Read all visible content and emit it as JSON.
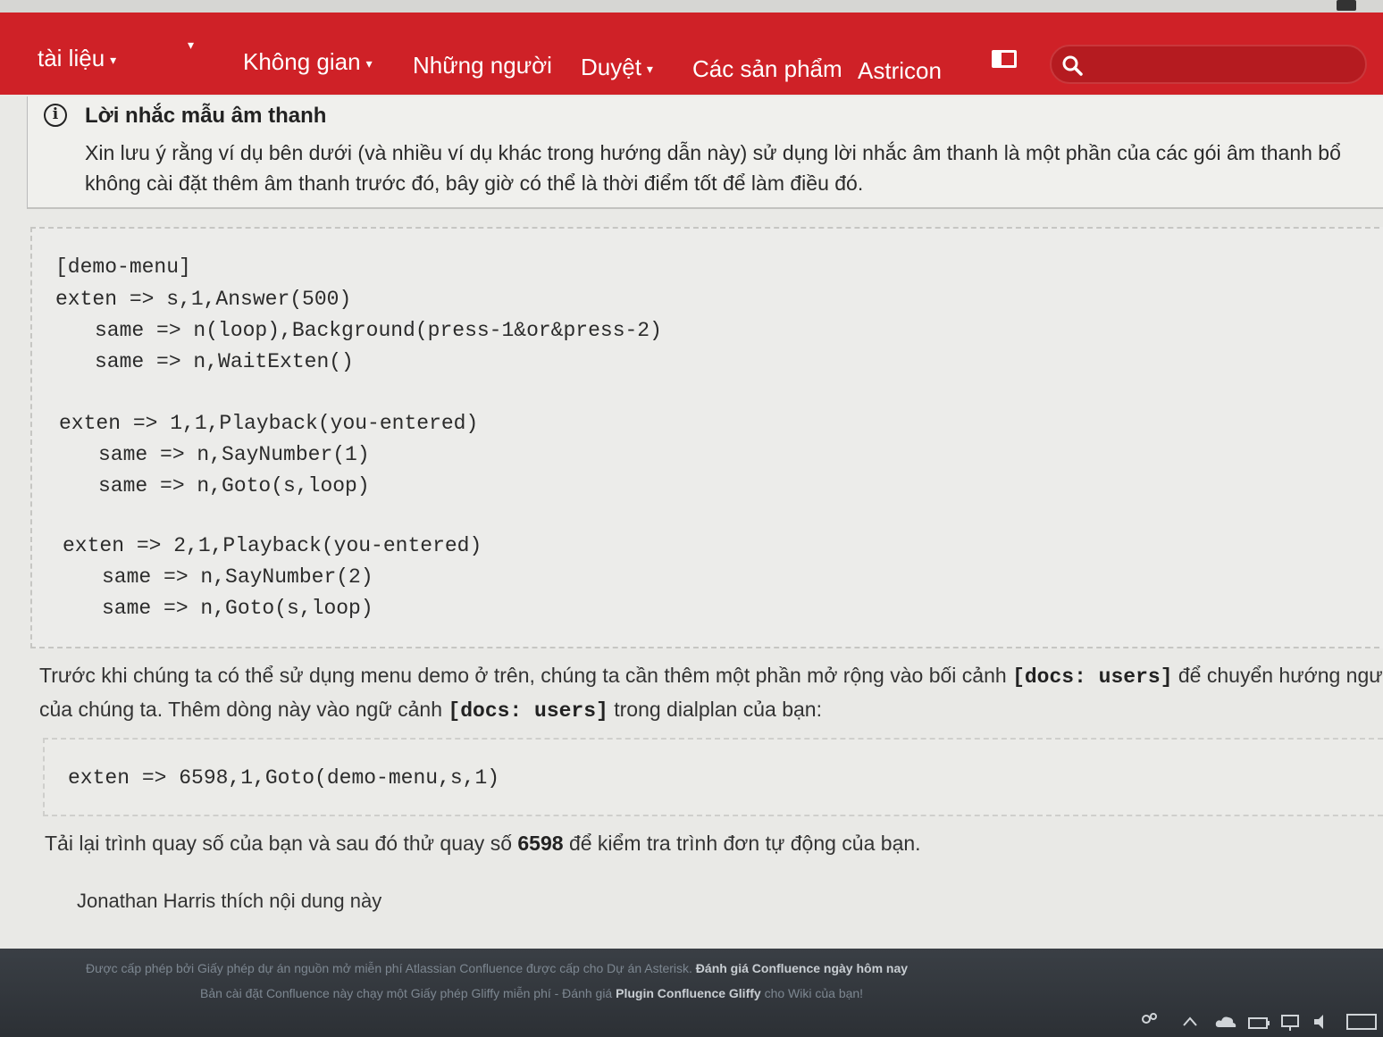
{
  "navbar": {
    "items": [
      {
        "label": "tài liệu",
        "caret": true
      },
      {
        "label": "Không gian",
        "caret": true
      },
      {
        "label": "Những người",
        "caret": false
      },
      {
        "label": "Duyệt",
        "caret": true
      },
      {
        "label": "Các sản phẩm",
        "caret": false
      },
      {
        "label": "Astricon",
        "caret": false
      }
    ],
    "caret_glyph": "▾",
    "search": {
      "placeholder": "",
      "value": ""
    },
    "colors": {
      "bar": "#cf2127",
      "search_bg": "#b51b20"
    }
  },
  "notice": {
    "icon": "info-icon",
    "icon_glyph": "i",
    "title": "Lời nhắc mẫu âm thanh",
    "body_line1": "Xin lưu ý rằng ví dụ bên dưới (và nhiều ví dụ khác trong hướng dẫn này) sử dụng lời nhắc âm thanh là một phần của các gói âm thanh bổ",
    "body_line2": "không cài đặt thêm âm thanh trước đó, bây giờ có thể là thời điểm tốt để làm điều đó."
  },
  "code_block": {
    "lines": [
      "[demo-menu]",
      "exten => s,1,Answer(500)",
      "same => n(loop),Background(press-1&or&press-2)",
      "same => n,WaitExten()",
      "exten => 1,1,Playback(you-entered)",
      "same => n,SayNumber(1)",
      "same => n,Goto(s,loop)",
      "exten => 2,1,Playback(you-entered)",
      "same => n,SayNumber(2)",
      "same => n,Goto(s,loop)"
    ]
  },
  "paragraph1": {
    "line1_before": "Trước khi chúng ta có thể sử dụng menu demo ở trên, chúng ta cần thêm một phần mở rộng vào bối cảnh ",
    "line1_code": "[docs: users]",
    "line1_after": " để chuyển hướng người",
    "line2_before": "của chúng ta. Thêm dòng này vào ngữ cảnh ",
    "line2_code": "[docs: users]",
    "line2_after": " trong dialplan của bạn:"
  },
  "code_block2": {
    "line": "exten => 6598,1,Goto(demo-menu,s,1)"
  },
  "paragraph2": {
    "before": "Tải lại trình quay số của bạn và sau đó thử quay số ",
    "bold": "6598",
    "after": " để kiểm tra trình đơn tự động của bạn."
  },
  "likes": "Jonathan Harris thích nội dung này",
  "footer": {
    "line1_text": "Được cấp phép bởi Giấy phép dự án nguồn mở miễn phí Atlassian Confluence được cấp cho Dự án Asterisk.",
    "line1_link": "Đánh giá Confluence ngày hôm nay",
    "line2_text": "Bản cài đặt Confluence này chạy một Giấy phép Gliffy miễn phí - Đánh giá",
    "line2_link": "Plugin Confluence Gliffy",
    "line2_after": "cho Wiki của bạn!"
  },
  "taskbar": {
    "icons": [
      "people-icon",
      "chevron-up-icon",
      "cloud-icon",
      "battery-icon",
      "network-icon",
      "volume-icon",
      "keyboard-icon"
    ]
  }
}
